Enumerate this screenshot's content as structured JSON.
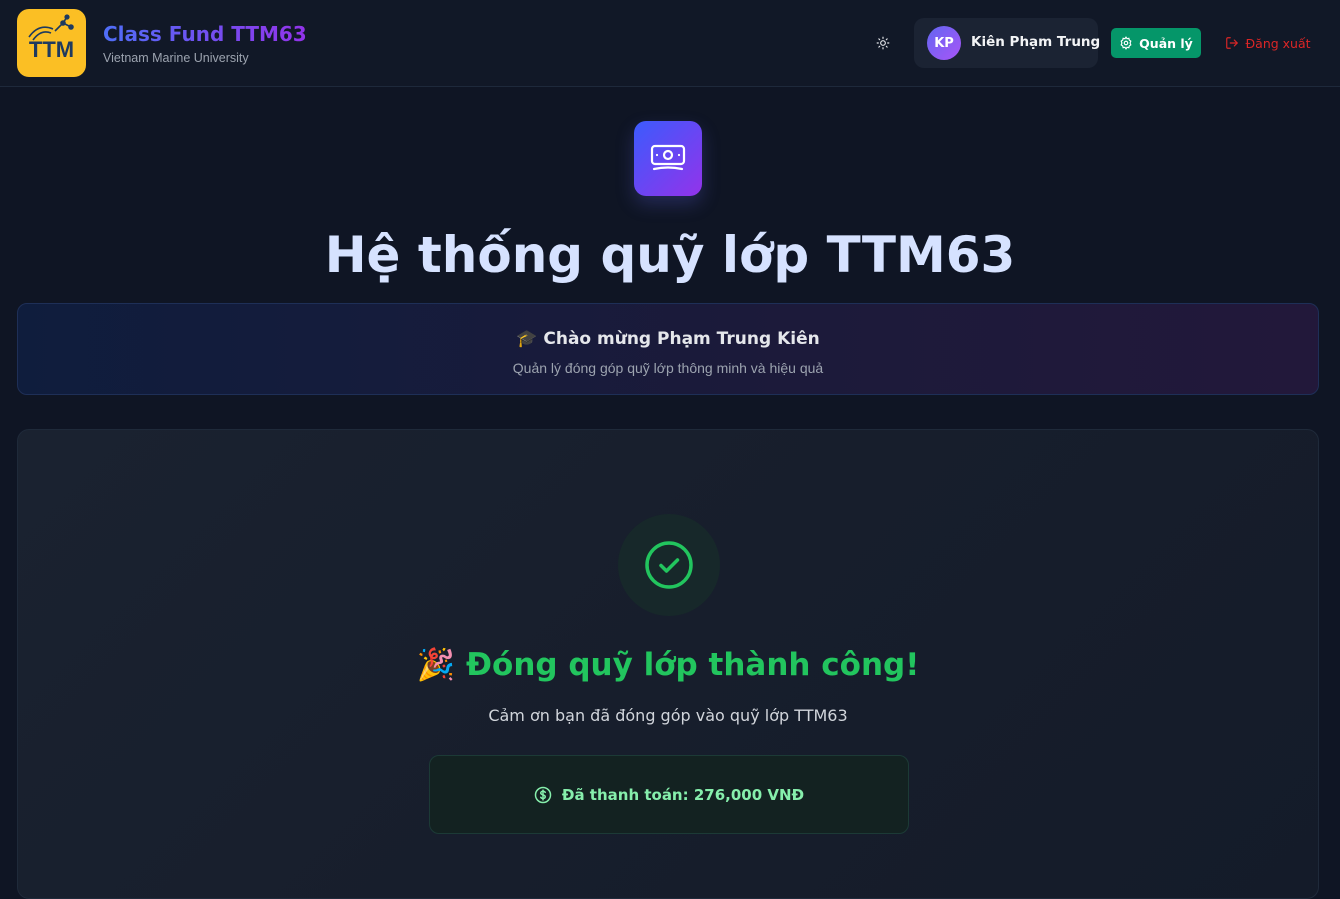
{
  "header": {
    "logo_text": "TTM",
    "brand_title": "Class Fund TTM63",
    "brand_subtitle": "Vietnam Marine University",
    "theme_icon": "sun-icon",
    "user": {
      "initials": "KP",
      "name": "Kiên Phạm Trung"
    },
    "manage_label": "Quản lý",
    "logout_label": "Đăng xuất"
  },
  "hero": {
    "icon": "money-icon",
    "title": "Hệ thống quỹ lớp TTM63"
  },
  "welcome": {
    "emoji": "🎓",
    "title": "Chào mừng Phạm Trung Kiên",
    "subtitle": "Quản lý đóng góp quỹ lớp thông minh và hiệu quả"
  },
  "result": {
    "icon": "check-circle-icon",
    "emoji": "🎉",
    "title": "Đóng quỹ lớp thành công!",
    "subtitle": "Cảm ơn bạn đã đóng góp vào quỹ lớp TTM63",
    "paid_text": "Đã thanh toán: 276,000 VNĐ"
  },
  "colors": {
    "background": "#0f1524",
    "accent_green": "#22c55e",
    "manage_button": "#059669",
    "logout": "#dc2626",
    "logo_bg": "#fbbf24"
  }
}
